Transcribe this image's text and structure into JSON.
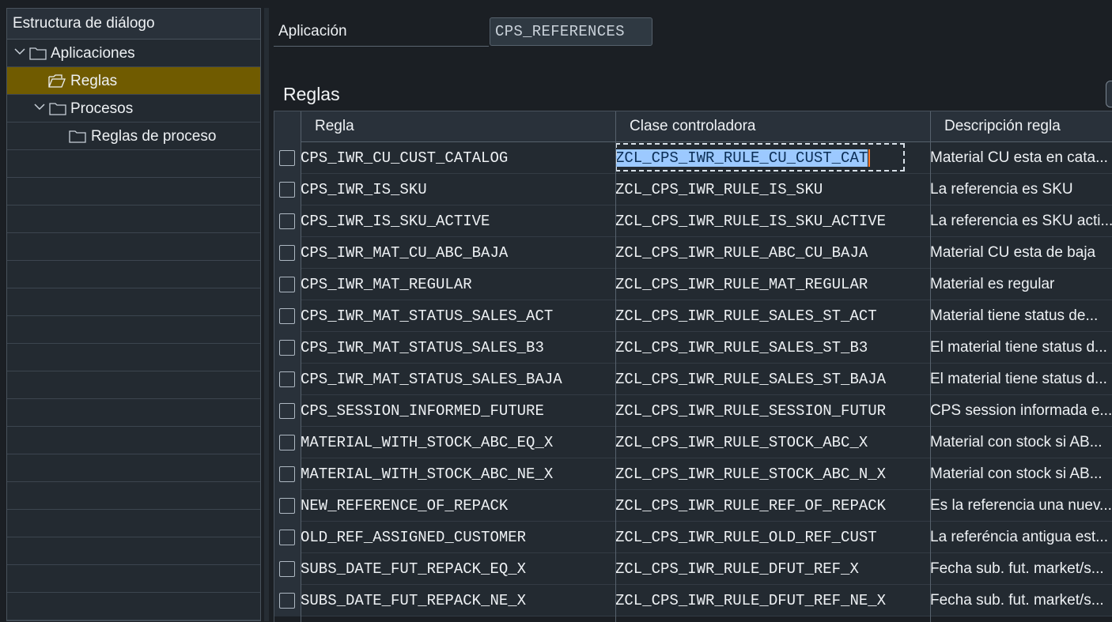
{
  "tree": {
    "header": "Estructura de diálogo",
    "items": [
      {
        "label": "Aplicaciones",
        "expanded": true,
        "level": 0,
        "icon": "folder-icon"
      },
      {
        "label": "Reglas",
        "selected": true,
        "level": 1,
        "icon": "folder-open-icon"
      },
      {
        "label": "Procesos",
        "expanded": true,
        "level": 1,
        "icon": "folder-icon"
      },
      {
        "label": "Reglas de proceso",
        "level": 2,
        "icon": "folder-icon"
      }
    ]
  },
  "form": {
    "application_label": "Aplicación",
    "application_value": "CPS_REFERENCES"
  },
  "section_title": "Reglas",
  "table": {
    "columns": [
      "Regla",
      "Clase controladora",
      "Descripción regla"
    ],
    "rows": [
      {
        "rule": "CPS_IWR_CU_CUST_CATALOG",
        "class": "ZCL_CPS_IWR_RULE_CU_CUST_CAT",
        "desc": "Material CU esta en cata..."
      },
      {
        "rule": "CPS_IWR_IS_SKU",
        "class": "ZCL_CPS_IWR_RULE_IS_SKU",
        "desc": "La referencia es SKU"
      },
      {
        "rule": "CPS_IWR_IS_SKU_ACTIVE",
        "class": "ZCL_CPS_IWR_RULE_IS_SKU_ACTIVE",
        "desc": "La referencia es SKU acti..."
      },
      {
        "rule": "CPS_IWR_MAT_CU_ABC_BAJA",
        "class": "ZCL_CPS_IWR_RULE_ABC_CU_BAJA",
        "desc": "Material CU esta de baja"
      },
      {
        "rule": "CPS_IWR_MAT_REGULAR",
        "class": "ZCL_CPS_IWR_RULE_MAT_REGULAR",
        "desc": "Material es regular"
      },
      {
        "rule": "CPS_IWR_MAT_STATUS_SALES_ACT",
        "class": "ZCL_CPS_IWR_RULE_SALES_ST_ACT",
        "desc": "Material tiene status de..."
      },
      {
        "rule": "CPS_IWR_MAT_STATUS_SALES_B3",
        "class": "ZCL_CPS_IWR_RULE_SALES_ST_B3",
        "desc": "El material tiene status d..."
      },
      {
        "rule": "CPS_IWR_MAT_STATUS_SALES_BAJA",
        "class": "ZCL_CPS_IWR_RULE_SALES_ST_BAJA",
        "desc": "El material tiene status d..."
      },
      {
        "rule": "CPS_SESSION_INFORMED_FUTURE",
        "class": "ZCL_CPS_IWR_RULE_SESSION_FUTUR",
        "desc": "CPS session informada e..."
      },
      {
        "rule": "MATERIAL_WITH_STOCK_ABC_EQ_X",
        "class": "ZCL_CPS_IWR_RULE_STOCK_ABC_X",
        "desc": "Material con stock si AB..."
      },
      {
        "rule": "MATERIAL_WITH_STOCK_ABC_NE_X",
        "class": "ZCL_CPS_IWR_RULE_STOCK_ABC_N_X",
        "desc": "Material con stock si AB..."
      },
      {
        "rule": "NEW_REFERENCE_OF_REPACK",
        "class": "ZCL_CPS_IWR_RULE_REF_OF_REPACK",
        "desc": "Es la referencia una nuev..."
      },
      {
        "rule": "OLD_REF_ASSIGNED_CUSTOMER",
        "class": "ZCL_CPS_IWR_RULE_OLD_REF_CUST",
        "desc": "La referéncia antigua est..."
      },
      {
        "rule": "SUBS_DATE_FUT_REPACK_EQ_X",
        "class": "ZCL_CPS_IWR_RULE_DFUT_REF_X",
        "desc": "Fecha sub. fut. market/s..."
      },
      {
        "rule": "SUBS_DATE_FUT_REPACK_NE_X",
        "class": "ZCL_CPS_IWR_RULE_DFUT_REF_NE_X",
        "desc": "Fecha sub. fut. market/s..."
      }
    ]
  },
  "colors": {
    "background": "#1b1f24",
    "panel": "#232a31",
    "selected_row": "#705b00",
    "text_highlight": "#9cc9ff",
    "caret": "#ff7a2a"
  }
}
